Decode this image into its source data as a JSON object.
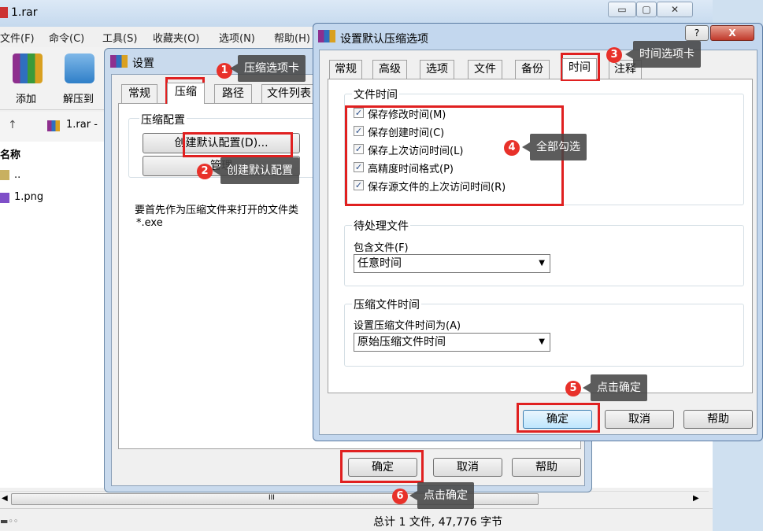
{
  "main": {
    "title": "1.rar",
    "menu": [
      "文件(F)",
      "命令(C)",
      "工具(S)",
      "收藏夹(O)",
      "选项(N)",
      "帮助(H)"
    ],
    "toolbar": {
      "add": "添加",
      "extract": "解压到"
    },
    "address": {
      "up_glyph": "↑",
      "path": "1.rar -"
    },
    "column_name": "名称",
    "files": [
      {
        "name": ".."
      },
      {
        "name": "1.png"
      }
    ],
    "scroll_label": "III",
    "status": "总计 1 文件, 47,776 字节"
  },
  "settings": {
    "title": "设置",
    "tabs": [
      "常规",
      "压缩",
      "路径",
      "文件列表"
    ],
    "compress_config_label": "压缩配置",
    "create_default_button": "创建默认配置(D)...",
    "manage_button": "管理",
    "open_as_archive_label": "要首先作为压缩文件来打开的文件类",
    "open_as_archive_value": "*.exe",
    "ok": "确定",
    "cancel": "取消",
    "help": "帮助"
  },
  "timedlg": {
    "title": "设置默认压缩选项",
    "help_glyph": "?",
    "close_glyph": "X",
    "tabs": [
      "常规",
      "高级",
      "选项",
      "文件",
      "备份",
      "时间",
      "注释"
    ],
    "file_time": {
      "label": "文件时间",
      "items": [
        {
          "label": "保存修改时间(M)",
          "checked": true
        },
        {
          "label": "保存创建时间(C)",
          "checked": true
        },
        {
          "label": "保存上次访问时间(L)",
          "checked": true
        },
        {
          "label": "高精度时间格式(P)",
          "checked": true
        },
        {
          "label": "保存源文件的上次访问时间(R)",
          "checked": true
        }
      ]
    },
    "pending": {
      "label": "待处理文件",
      "include_label": "包含文件(F)",
      "include_value": "任意时间"
    },
    "archive_time": {
      "label": "压缩文件时间",
      "set_label": "设置压缩文件时间为(A)",
      "set_value": "原始压缩文件时间"
    },
    "ok": "确定",
    "cancel": "取消",
    "help": "帮助"
  },
  "annotations": [
    {
      "n": "1",
      "text": "压缩选项卡"
    },
    {
      "n": "2",
      "text": "创建默认配置"
    },
    {
      "n": "3",
      "text": "时间选项卡"
    },
    {
      "n": "4",
      "text": "全部勾选"
    },
    {
      "n": "5",
      "text": "点击确定"
    },
    {
      "n": "6",
      "text": "点击确定"
    }
  ],
  "colors": {
    "annotation_red": "#e02020",
    "callout_bg": "#464646",
    "winrar_red": "#c0392b"
  }
}
